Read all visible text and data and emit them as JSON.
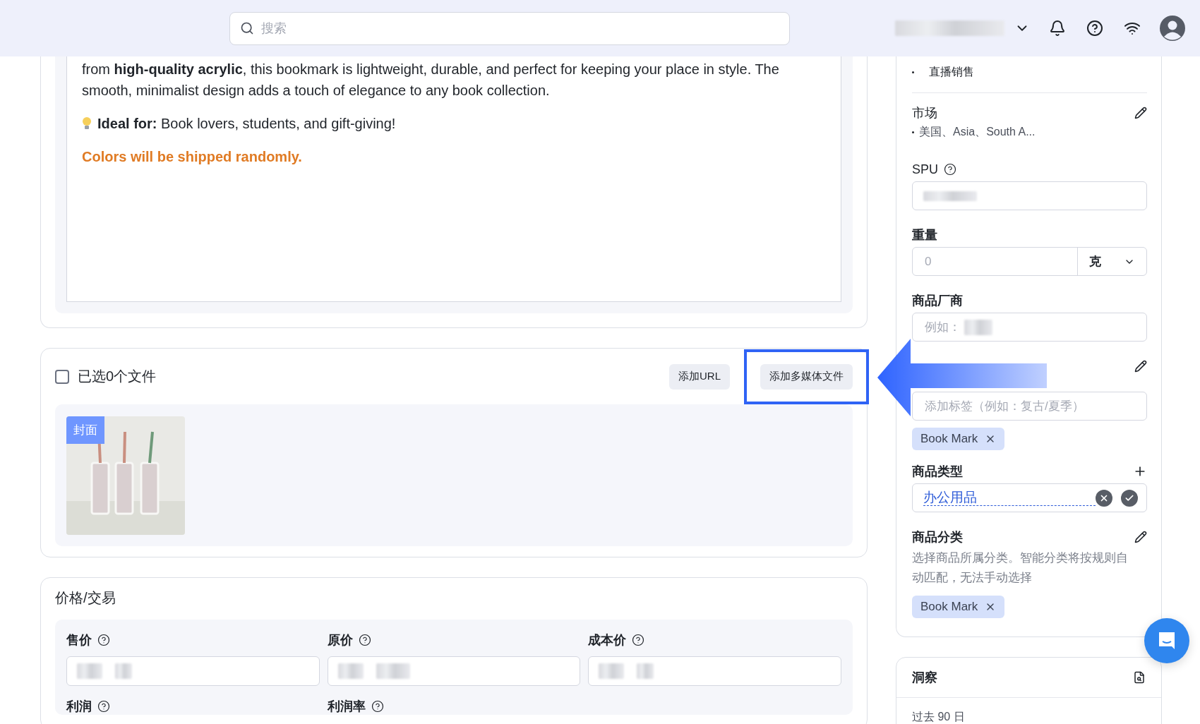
{
  "header": {
    "search": {
      "placeholder": "搜索"
    }
  },
  "description": {
    "paragraphs": [
      {
        "kind": "text",
        "text": "from **high-quality acrylic**, this bookmark is lightweight, durable, and perfect for keeping your place in style. The smooth, minimalist design adds a touch of elegance to any book collection."
      },
      {
        "kind": "tip",
        "text": "**Ideal for:** Book lovers, students, and gift-giving!"
      },
      {
        "kind": "notice",
        "text": "Colors will be shipped randomly."
      }
    ]
  },
  "media": {
    "select_label": "已选0个文件",
    "checked": false,
    "buttons": [
      {
        "label": "添加URL",
        "highlighted": false
      },
      {
        "label": "添加多媒体文件",
        "highlighted": true
      }
    ],
    "items": [
      {
        "kind": "picture",
        "badge": "封面"
      }
    ]
  },
  "pricing": {
    "title": "价格/交易",
    "fields": [
      {
        "label": "售价",
        "kind": "input"
      },
      {
        "label": "原价",
        "kind": "input"
      },
      {
        "label": "成本价",
        "kind": "input"
      },
      {
        "label": "利润",
        "kind": "label"
      },
      {
        "label": "利润率",
        "kind": "label"
      }
    ]
  },
  "sidebar": {
    "sales_channels": [
      "直播销售"
    ],
    "market": {
      "label": "市场",
      "value": "美国、Asia、South A..."
    },
    "spu": {
      "label": "SPU"
    },
    "weight": {
      "label": "重量",
      "placeholder": "0",
      "unit": "克"
    },
    "vendor": {
      "label": "商品厂商",
      "placeholder": "例如："
    },
    "tags": {
      "placeholder": "添加标签（例如：复古/夏季）",
      "chips": [
        "Book Mark"
      ]
    },
    "product_type": {
      "label": "商品类型",
      "value": "办公用品"
    },
    "category": {
      "label": "商品分类",
      "hint": "选择商品所属分类。智能分类将按规则自动匹配，无法手动选择",
      "chips": [
        "Book Mark"
      ]
    }
  },
  "insights": {
    "title": "洞察",
    "period": "过去 90 日"
  }
}
